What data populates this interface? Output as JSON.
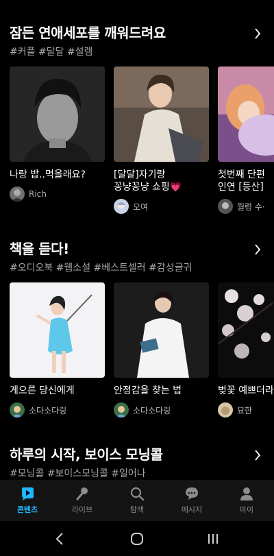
{
  "sections": [
    {
      "title": "잠든 연애세포를 깨워드려요",
      "tags": "#커플 #달달 #설렘",
      "cards": [
        {
          "title": "나랑 밥..먹을래요?",
          "author": "Rich",
          "avatar_color": "#777777"
        },
        {
          "title": "[달달]자기랑\n꽁냥꽁냥 쇼핑💗",
          "author": "오여",
          "avatar_color": "#c9d3e6"
        },
        {
          "title": "첫번째 단편 \n인연 [등산]",
          "author": "월령 수·",
          "avatar_color": "#555555"
        }
      ]
    },
    {
      "title": "책을 듣다!",
      "tags": "#오디오북 #웹소설 #베스트셀러 #감성글귀",
      "cards": [
        {
          "title": "게으른 당신에게",
          "author": "소다소다링",
          "avatar_color": "#3a6f4a"
        },
        {
          "title": "안정감을 찾는 법",
          "author": "소다소다링",
          "avatar_color": "#3a6f4a"
        },
        {
          "title": "벚꽃 예쁘더라",
          "author": "묘한",
          "avatar_color": "#d8c8a8"
        }
      ]
    },
    {
      "title": "하루의 시작, 보이스 모닝콜",
      "tags": "#모닝콜 #보이스모닝콜 #일어나"
    }
  ],
  "tabs": [
    {
      "label": "콘텐츠",
      "icon": "contents-icon",
      "active": true
    },
    {
      "label": "라이브",
      "icon": "mic-icon",
      "active": false
    },
    {
      "label": "탐색",
      "icon": "search-icon",
      "active": false
    },
    {
      "label": "메시지",
      "icon": "message-icon",
      "active": false
    },
    {
      "label": "마이",
      "icon": "person-icon",
      "active": false
    }
  ],
  "colors": {
    "accent": "#1fb6ff",
    "background": "#000000",
    "tabbar": "#141414"
  }
}
